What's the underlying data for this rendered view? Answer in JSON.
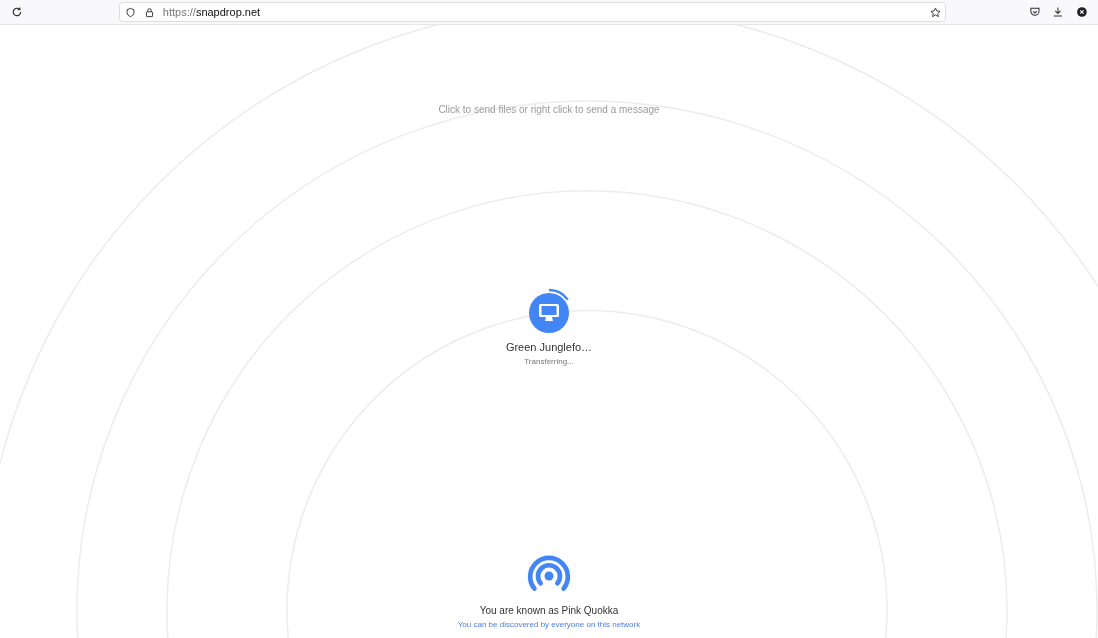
{
  "browser": {
    "url_scheme": "https://",
    "url_host": "snapdrop.net"
  },
  "instructions": "Click to send files or right click to send a message",
  "peers": [
    {
      "name": "Green Junglefo…",
      "status": "Transferring...",
      "progress": {
        "level": 0.15
      }
    }
  ],
  "footer": {
    "display_name": "You are known as Pink Quokka",
    "discovery": "You can be discovered by everyone on this network"
  }
}
